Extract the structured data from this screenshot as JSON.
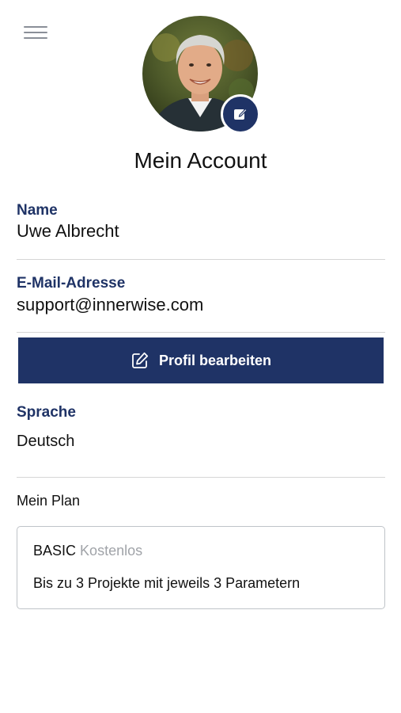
{
  "header": {
    "menu_icon": "hamburger-menu-icon",
    "avatar_edit_icon": "edit-pencil-icon",
    "title": "Mein Account"
  },
  "profile": {
    "name_label": "Name",
    "name_value": "Uwe Albrecht",
    "email_label": "E-Mail-Adresse",
    "email_value": "support@innerwise.com",
    "edit_button_label": "Profil bearbeiten",
    "edit_button_icon": "edit-square-icon"
  },
  "language": {
    "label": "Sprache",
    "value": "Deutsch"
  },
  "plan": {
    "section_label": "Mein Plan",
    "name": "BASIC",
    "price": "Kostenlos",
    "description": "Bis zu 3 Projekte mit jeweils 3 Parametern"
  },
  "colors": {
    "accent": "#1f3366",
    "divider": "#d6d6d6",
    "muted_text": "#a0a3a8"
  }
}
